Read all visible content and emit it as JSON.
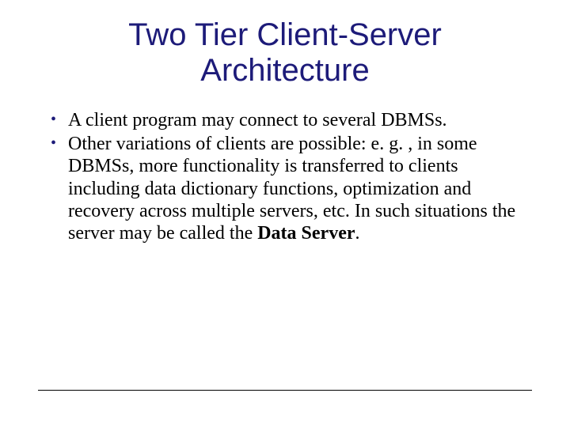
{
  "slide": {
    "title": "Two Tier Client-Server Architecture",
    "bullets": [
      {
        "text": "A client program may connect to several DBMSs."
      },
      {
        "prefix": "Other variations of clients are possible: e. g. , in some DBMSs, more functionality is transferred to clients including data dictionary functions, optimization and recovery across multiple servers, etc. In such situations the server may be called the ",
        "strong": "Data Server",
        "suffix": "."
      }
    ]
  }
}
